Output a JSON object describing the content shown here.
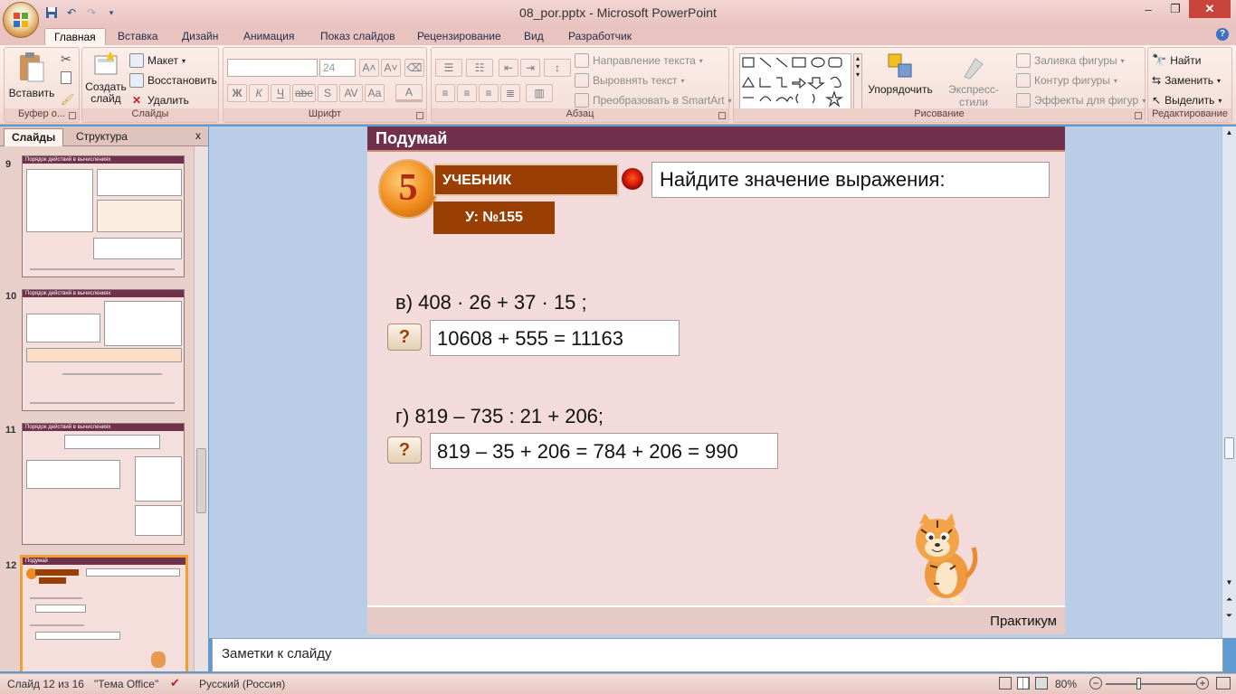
{
  "app": {
    "window_title": "08_por.pptx - Microsoft PowerPoint",
    "win_controls": {
      "minimize": "‒",
      "restore": "❐",
      "close": "✕"
    }
  },
  "tabs": [
    "Главная",
    "Вставка",
    "Дизайн",
    "Анимация",
    "Показ слайдов",
    "Рецензирование",
    "Вид",
    "Разработчик"
  ],
  "ribbon": {
    "clipboard": {
      "paste": "Вставить",
      "group": "Буфер о..."
    },
    "slides": {
      "new_slide": "Создать слайд",
      "layout": "Макет",
      "reset": "Восстановить",
      "delete": "Удалить",
      "group": "Слайды"
    },
    "font": {
      "size": "24",
      "group": "Шрифт",
      "bold": "Ж",
      "italic": "К",
      "underline": "Ч",
      "strike": "abe",
      "shadow": "S",
      "spacing": "AV",
      "case": "Aa",
      "color": "A"
    },
    "paragraph": {
      "text_direction": "Направление текста",
      "align_text": "Выровнять текст",
      "smartart": "Преобразовать в SmartArt",
      "group": "Абзац"
    },
    "drawing": {
      "arrange": "Упорядочить",
      "quick_styles": "Экспресс-стили",
      "fill": "Заливка фигуры",
      "outline": "Контур фигуры",
      "effects": "Эффекты для фигур",
      "group": "Рисование"
    },
    "editing": {
      "find": "Найти",
      "replace": "Заменить",
      "select": "Выделить",
      "group": "Редактирование"
    }
  },
  "left_panel": {
    "tab_slides": "Слайды",
    "tab_outline": "Структура",
    "close": "x",
    "thumbs": [
      {
        "num": "9",
        "title": "Порядок действий в вычислениях"
      },
      {
        "num": "10",
        "title": "Порядок действий в вычислениях"
      },
      {
        "num": "11",
        "title": "Порядок действий в вычислениях"
      },
      {
        "num": "12",
        "title": "Подумай",
        "selected": true
      }
    ]
  },
  "slide": {
    "title": "Подумай",
    "number": "5",
    "textbook": "УЧЕБНИК",
    "exercise": "У: №155",
    "task": "Найдите значение выражения:",
    "items": [
      {
        "expression": "в) 408 · 26 + 37 · 15 ;",
        "button": "?",
        "answer": "10608 + 555 = 11163"
      },
      {
        "expression": "г) 819 – 735 : 21 + 206;",
        "button": "?",
        "answer": "819 – 35 + 206 = 784 + 206 = 990"
      }
    ],
    "footer": "Практикум"
  },
  "notes": {
    "placeholder": "Заметки к слайду"
  },
  "status": {
    "slide": "Слайд 12 из 16",
    "theme": "\"Тема Office\"",
    "language": "Русский (Россия)",
    "zoom": "80%"
  },
  "colors": {
    "slide_header": "#71304b",
    "accent_brown": "#993f04",
    "slide_bg": "#f3dadb"
  }
}
